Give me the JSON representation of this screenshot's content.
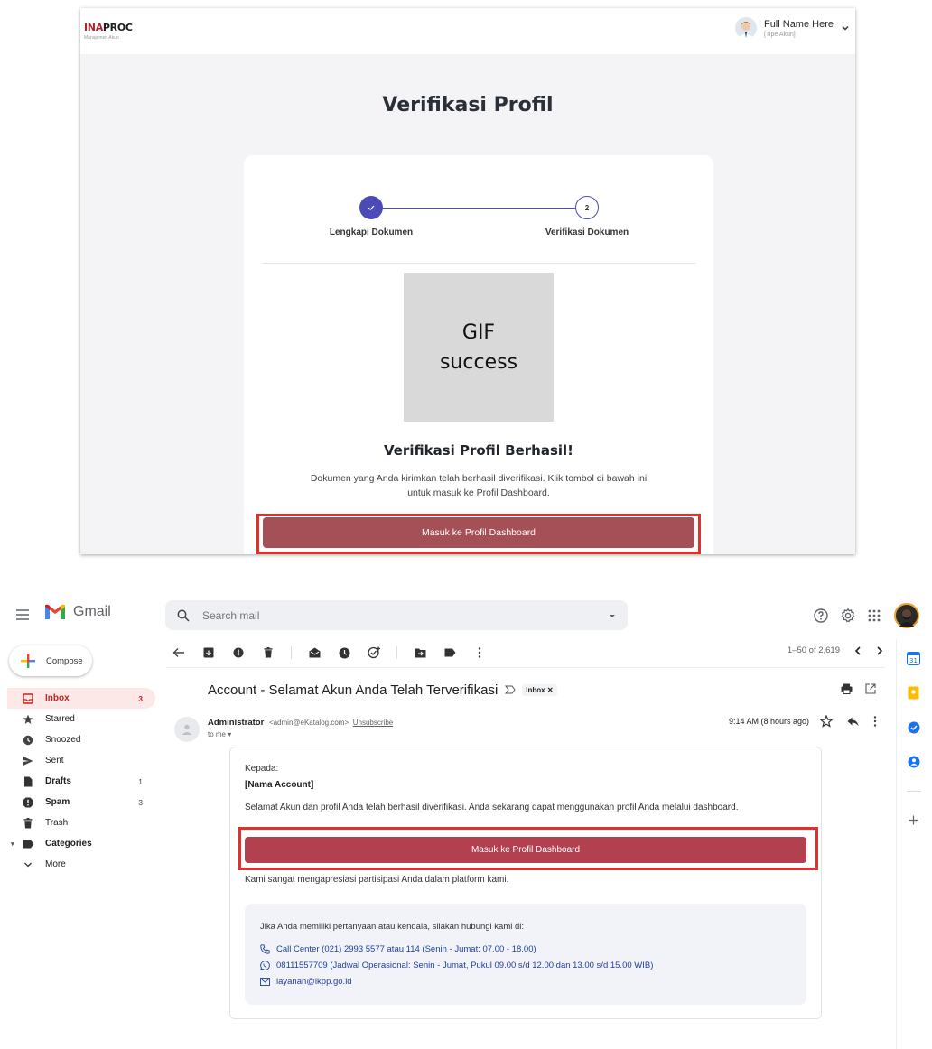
{
  "inaproc": {
    "logo": {
      "brand_red": "INA",
      "brand_dark": "PROC",
      "subtitle": "Manajemen Akun"
    },
    "user": {
      "name": "Full Name Here",
      "type": "[Tipe Akun]"
    },
    "page_title": "Verifikasi Profil",
    "stepper": {
      "step1": {
        "label": "Lengkapi Dokumen",
        "status": "completed"
      },
      "step2": {
        "number": "2",
        "label": "Verifikasi Dokumen",
        "status": "current"
      }
    },
    "gif_placeholder": {
      "line1": "GIF",
      "line2": "success"
    },
    "success_title": "Verifikasi Profil Berhasil!",
    "success_desc": "Dokumen yang Anda kirimkan telah berhasil diverifikasi. Klik tombol di bawah ini untuk masuk ke Profil Dashboard.",
    "dashboard_button": "Masuk ke Profil Dashboard",
    "colors": {
      "primary": "#4a4bb6",
      "button": "#a54f56",
      "highlight": "#e0322c"
    }
  },
  "gmail": {
    "app_name": "Gmail",
    "search": {
      "placeholder": "Search mail"
    },
    "compose_label": "Compose",
    "nav": [
      {
        "label": "Inbox",
        "count": "3",
        "icon": "inbox-icon",
        "active": true
      },
      {
        "label": "Starred",
        "count": "",
        "icon": "star-icon"
      },
      {
        "label": "Snoozed",
        "count": "",
        "icon": "clock-icon"
      },
      {
        "label": "Sent",
        "count": "",
        "icon": "send-icon"
      },
      {
        "label": "Drafts",
        "count": "1",
        "icon": "draft-icon",
        "bold": true
      },
      {
        "label": "Spam",
        "count": "3",
        "icon": "spam-icon",
        "bold": true
      },
      {
        "label": "Trash",
        "count": "",
        "icon": "trash-icon"
      },
      {
        "label": "Categories",
        "count": "",
        "icon": "label-icon",
        "bold": true
      },
      {
        "label": "More",
        "count": "",
        "icon": "chevron-down-icon"
      }
    ],
    "pagination": "1–50 of 2,619",
    "subject": "Account - Selamat Akun Anda Telah Terverifikasi",
    "label_chip": "Inbox",
    "sender": {
      "name": "Administrator",
      "email": "<admin@eKatalog.com>",
      "unsubscribe": "Unsubscribe",
      "to": "to me"
    },
    "time": "9:14 AM (8 hours ago)",
    "body": {
      "greeting": "Kepada:",
      "account_name": "[Nama Account]",
      "message": "Selamat Akun dan profil Anda telah berhasil diverifikasi. Anda sekarang dapat menggunakan profil Anda melalui dashboard.",
      "button": "Masuk ke Profil Dashboard",
      "appreciation": "Kami sangat mengapresiasi partisipasi Anda dalam platform kami.",
      "contact_intro": "Jika Anda memiliki pertanyaan atau kendala, silakan hubungi kami di:",
      "contacts": [
        {
          "icon": "phone-icon",
          "text": "Call Center (021) 2993 5577 atau 114 (Senin - Jumat: 07.00 - 18.00)"
        },
        {
          "icon": "whatsapp-icon",
          "text": "08111557709 (Jadwal Operasional: Senin - Jumat, Pukul 09.00 s/d 12.00 dan  13.00 s/d 15.00 WIB)"
        },
        {
          "icon": "mail-icon",
          "text": "layanan@lkpp.go.id"
        }
      ]
    },
    "colors": {
      "inbox_active": "#c5221f",
      "button": "#b2404f",
      "link": "#1f3f9f"
    }
  }
}
